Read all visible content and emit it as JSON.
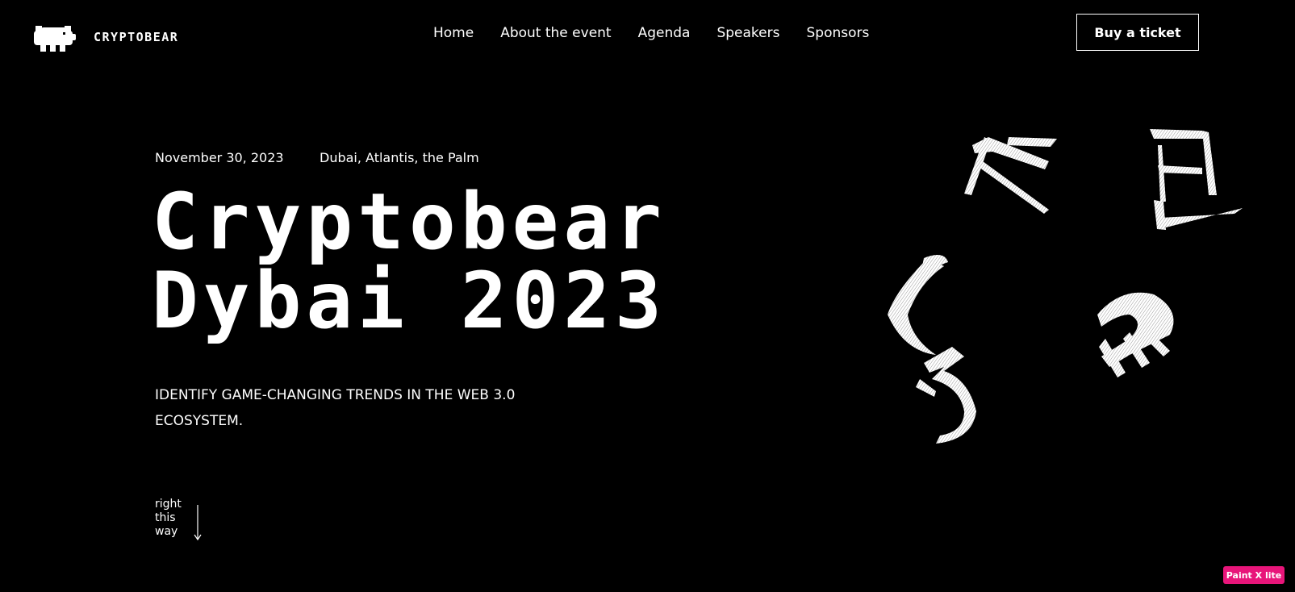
{
  "header": {
    "brand": "CRYPTOBEAR",
    "logo_icon": "bear-logo-icon",
    "nav": [
      {
        "label": "Home"
      },
      {
        "label": "About the event"
      },
      {
        "label": "Agenda"
      },
      {
        "label": "Speakers"
      },
      {
        "label": "Sponsors"
      }
    ],
    "cta_label": "Buy a ticket"
  },
  "hero": {
    "date": "November 30, 2023",
    "location": "Dubai, Atlantis, the Palm",
    "title_line1": "Cryptobear",
    "title_line2": "Dybai 2023",
    "tagline": "IDENTIFY GAME-CHANGING TRENDS IN THE WEB 3.0 ECOSYSTEM.",
    "scroll_hint": [
      "right",
      "this",
      "way"
    ],
    "scroll_icon": "arrow-down-icon"
  },
  "decoration": {
    "icon": "floating-3d-letters-icon"
  },
  "badge": {
    "label": "Paint X lite",
    "color": "#e8157a"
  },
  "colors": {
    "background": "#000000",
    "foreground": "#ffffff"
  }
}
